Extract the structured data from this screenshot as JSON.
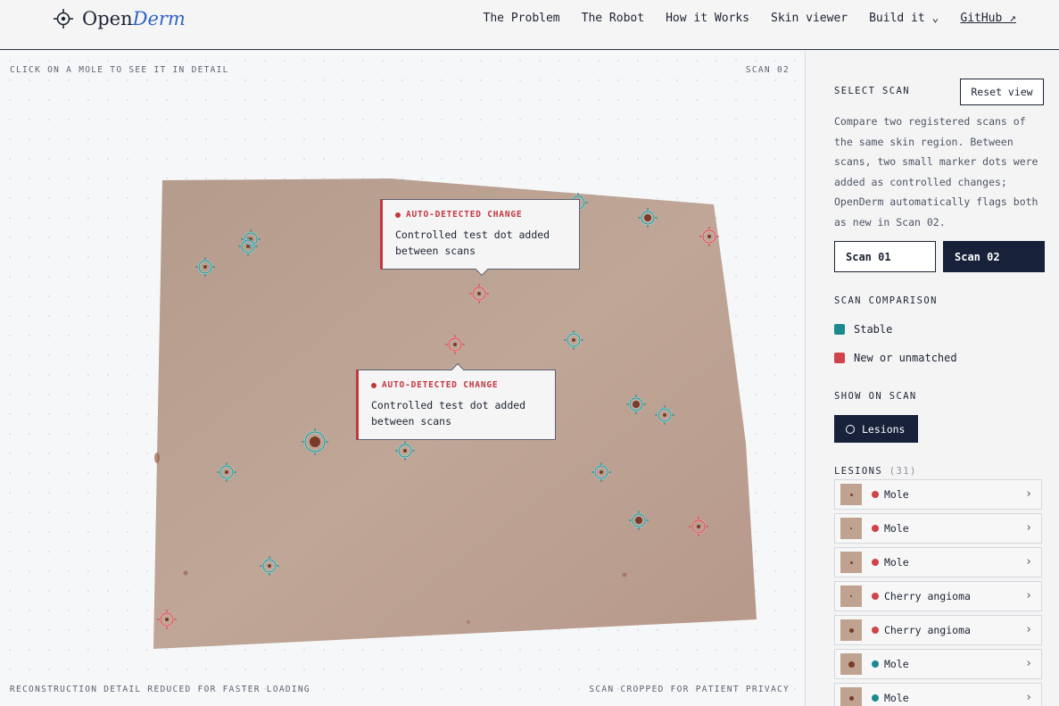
{
  "header": {
    "logo_prefix": "Open",
    "logo_accent": "Derm",
    "nav": {
      "problem": "The Problem",
      "robot": "The Robot",
      "how": "How it Works",
      "viewer": "Skin viewer",
      "build": "Build it ⌄",
      "github": "GitHub ↗"
    }
  },
  "viewer": {
    "top_left": "CLICK ON A MOLE TO SEE IT IN DETAIL",
    "top_right": "SCAN 02",
    "bottom_left": "RECONSTRUCTION DETAIL REDUCED FOR FASTER LOADING",
    "bottom_right": "SCAN CROPPED FOR PATIENT PRIVACY",
    "tooltips": [
      {
        "head": "AUTO-DETECTED CHANGE",
        "body": "Controlled test dot added between scans"
      },
      {
        "head": "AUTO-DETECTED CHANGE",
        "body": "Controlled test dot added between scans"
      }
    ]
  },
  "colors": {
    "stable": "#1a8a8e",
    "new": "#d1434b",
    "navy": "#17213a"
  },
  "sidebar": {
    "select_scan": "SELECT SCAN",
    "reset": "Reset view",
    "description": "Compare two registered scans of the same skin region. Between scans, two small marker dots were added as controlled changes; OpenDerm automatically flags both as new in Scan 02.",
    "scan1": "Scan 01",
    "scan2": "Scan 02",
    "comparison_heading": "SCAN COMPARISON",
    "stable_label": "Stable",
    "new_label": "New or unmatched",
    "show_heading": "SHOW ON SCAN",
    "lesions_toggle": "Lesions",
    "lesions_heading": "LESIONS",
    "lesions_count": "(31)",
    "lesions": [
      {
        "label": "Mole",
        "status": "new"
      },
      {
        "label": "Mole",
        "status": "new"
      },
      {
        "label": "Mole",
        "status": "new"
      },
      {
        "label": "Cherry angioma",
        "status": "new"
      },
      {
        "label": "Cherry angioma",
        "status": "new"
      },
      {
        "label": "Mole",
        "status": "stable"
      },
      {
        "label": "Mole",
        "status": "stable"
      }
    ]
  }
}
